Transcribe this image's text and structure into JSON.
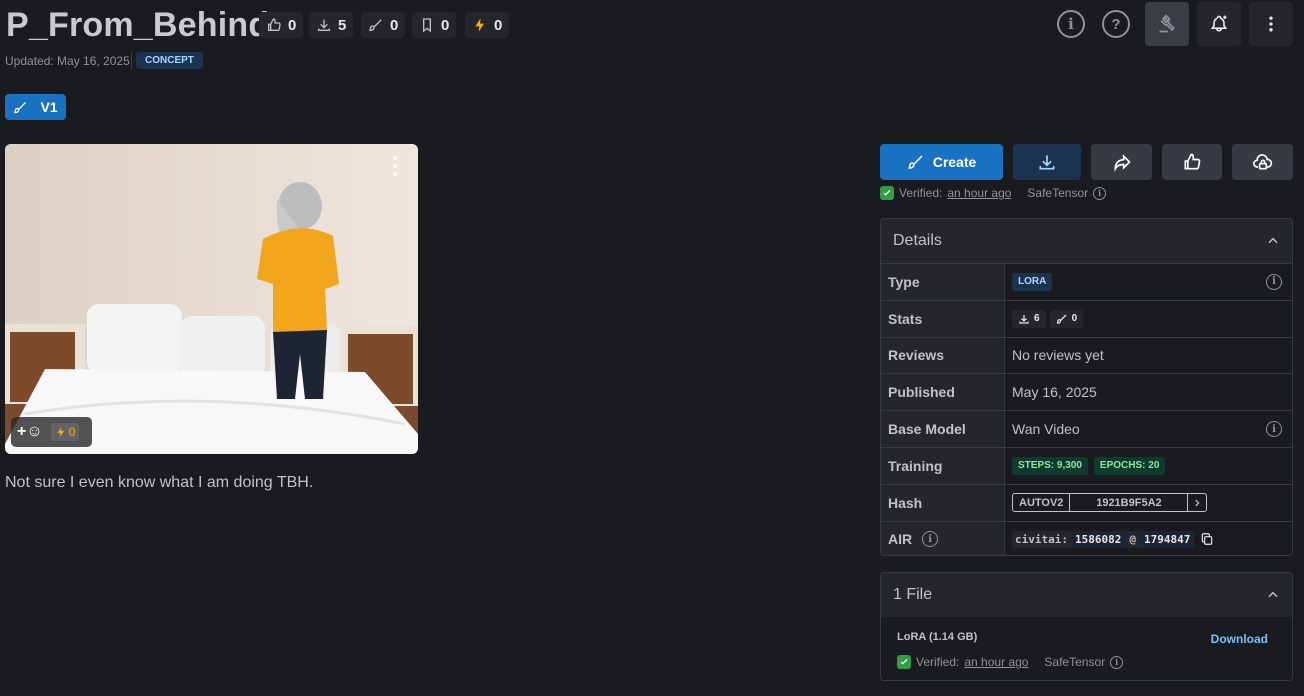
{
  "header": {
    "title": "P_From_Behind",
    "stats": {
      "likes": "0",
      "downloads": "5",
      "generations": "0",
      "bookmarks": "0",
      "buzz": "0"
    },
    "updated_text": "Updated: May 16, 2025",
    "category_badge": "CONCEPT"
  },
  "version_tab": {
    "label": "V1"
  },
  "image_card": {
    "reaction_buzz": "0"
  },
  "description": "Not sure I even know what I am doing TBH.",
  "actions": {
    "create_label": "Create"
  },
  "verification": {
    "verified_label": "Verified:",
    "verified_time": "an hour ago",
    "format": "SafeTensor"
  },
  "details": {
    "heading": "Details",
    "type_label": "Type",
    "type_value": "LORA",
    "stats_label": "Stats",
    "stats_downloads": "6",
    "stats_generations": "0",
    "reviews_label": "Reviews",
    "reviews_value": "No reviews yet",
    "published_label": "Published",
    "published_value": "May 16, 2025",
    "base_model_label": "Base Model",
    "base_model_value": "Wan Video",
    "training_label": "Training",
    "training_steps": "STEPS: 9,300",
    "training_epochs": "EPOCHS: 20",
    "hash_label": "Hash",
    "hash_type": "AUTOV2",
    "hash_value": "1921B9F5A2",
    "air_label": "AIR",
    "air_prefix": "civitai:",
    "air_model": "1586082",
    "air_at": "@",
    "air_version": "1794847"
  },
  "files": {
    "heading": "1 File",
    "file_name": "LoRA (1.14 GB)",
    "download_label": "Download",
    "verified_label": "Verified:",
    "verified_time": "an hour ago",
    "format": "SafeTensor"
  },
  "colors": {
    "accent": "#1971c2",
    "background": "#1a1b1e",
    "panel": "#25262b",
    "verified": "#2f9e44",
    "buzz": "#fab005"
  }
}
